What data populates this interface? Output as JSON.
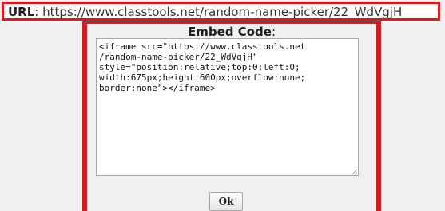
{
  "url_bar": {
    "label": "URL",
    "separator": ": ",
    "value": "https://www.classtools.net/random-name-picker/22_WdVgjH"
  },
  "embed": {
    "title": "Embed Code",
    "title_suffix": ":",
    "code": "<iframe src=\"https://www.classtools.net\n/random-name-picker/22_WdVgjH\"\nstyle=\"position:relative;top:0;left:0;\nwidth:675px;height:600px;overflow:none;\nborder:none\"></iframe>",
    "ok_label": "Ok"
  },
  "colors": {
    "highlight_border": "#e8141c",
    "background": "#f0f0f0"
  }
}
